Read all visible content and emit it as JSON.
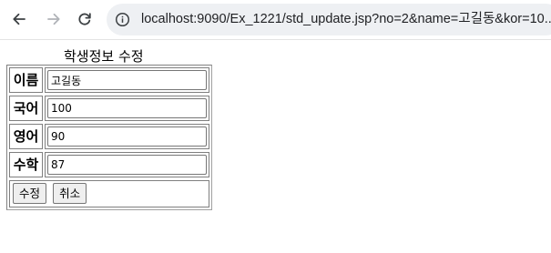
{
  "browser": {
    "url": "localhost:9090/Ex_1221/std_update.jsp?no=2&name=고길동&kor=10..."
  },
  "page": {
    "heading": "학생정보 수정"
  },
  "form": {
    "fields": [
      {
        "label": "이름",
        "value": "고길동"
      },
      {
        "label": "국어",
        "value": "100"
      },
      {
        "label": "영어",
        "value": "90"
      },
      {
        "label": "수학",
        "value": "87"
      }
    ],
    "buttons": {
      "submit": "수정",
      "cancel": "취소"
    }
  },
  "icons": {
    "back": "back-arrow-icon",
    "forward": "forward-arrow-icon",
    "reload": "reload-icon",
    "site_info": "info-icon"
  }
}
